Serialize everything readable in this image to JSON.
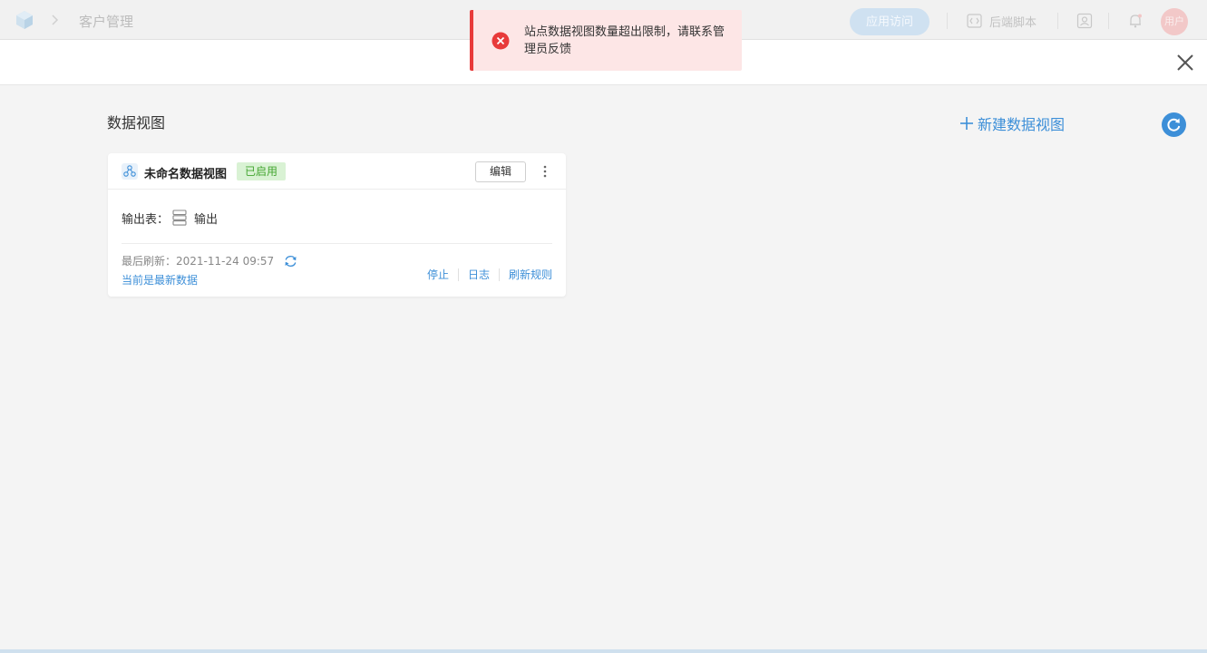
{
  "topbar": {
    "app_name": "客户管理",
    "visit_button": "应用访问",
    "backend_script": "后端脚本",
    "avatar_text": "用户"
  },
  "main": {
    "section_title": "数据视图",
    "new_view_button": "新建数据视图"
  },
  "card": {
    "name": "未命名数据视图",
    "status": "已启用",
    "edit_button": "编辑",
    "output_label": "输出表：",
    "output_name": "输出",
    "last_refresh_label": "最后刷新：",
    "last_refresh_time": "2021-11-24 09:57",
    "latest_status": "当前是最新数据",
    "actions": {
      "stop": "停止",
      "log": "日志",
      "refresh_rules": "刷新规则"
    }
  },
  "toast": {
    "type": "error",
    "message": "站点数据视图数量超出限制，请联系管理员反馈"
  },
  "colors": {
    "accent": "#3d8fd8",
    "success_bg": "#d9f2d4",
    "success_text": "#43a530",
    "error": "#e83a3a",
    "error_bg": "#fde6e6"
  }
}
